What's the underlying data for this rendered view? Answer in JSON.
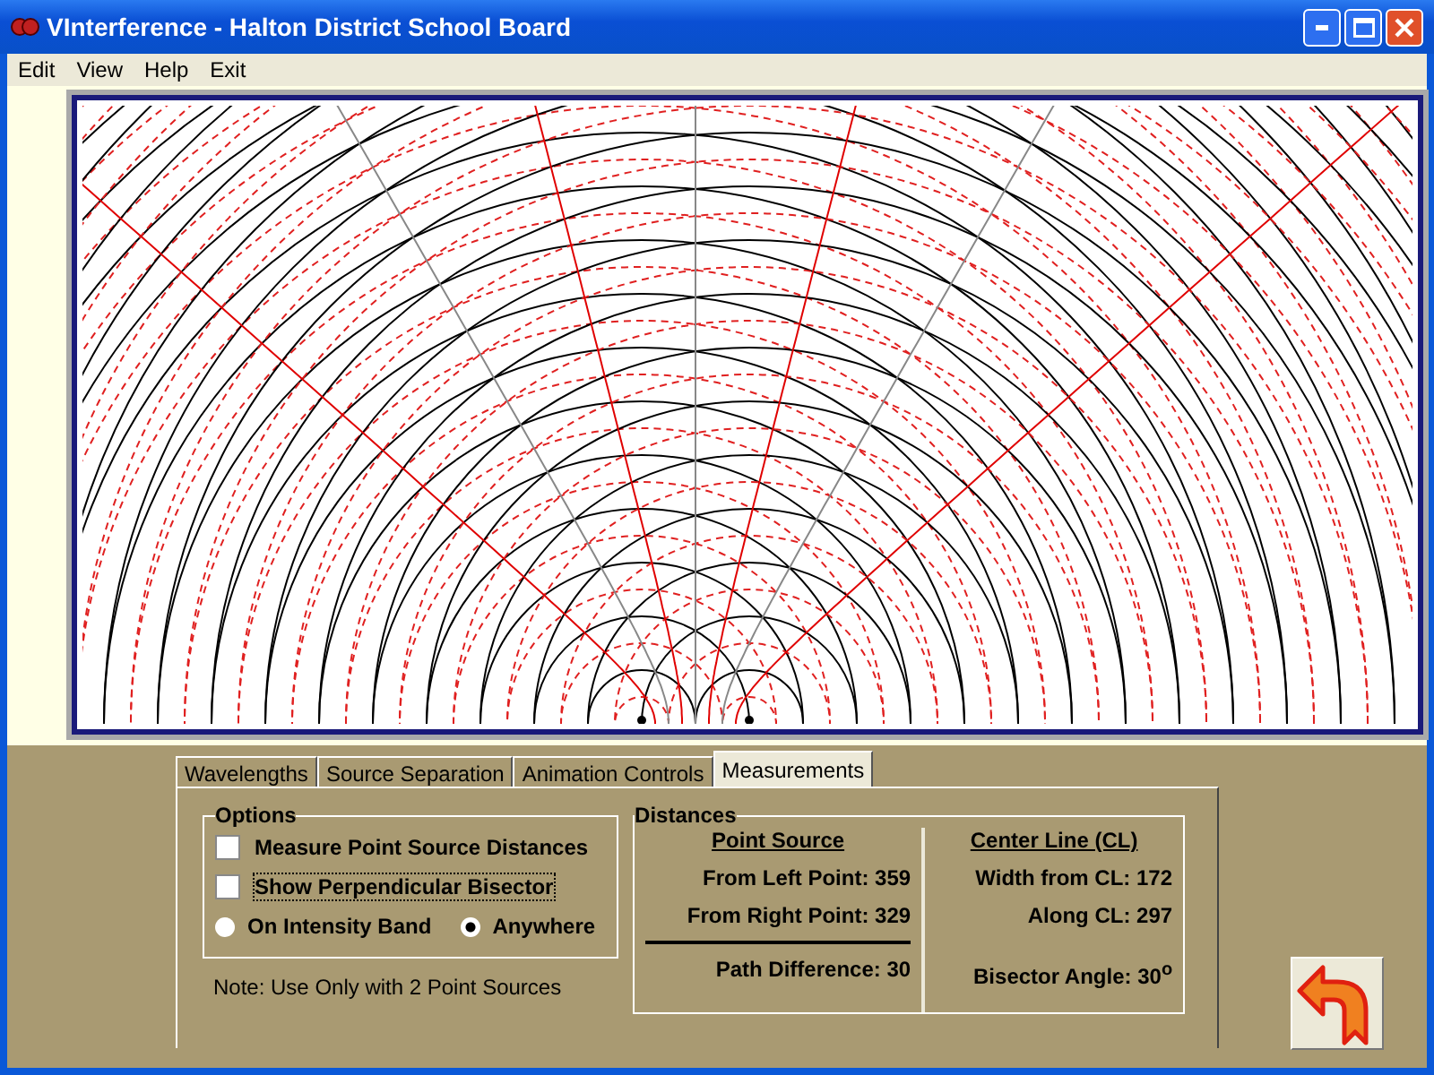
{
  "window": {
    "title": "VInterference - Halton District School Board"
  },
  "menu": [
    "Edit",
    "View",
    "Help",
    "Exit"
  ],
  "tabs": [
    {
      "label": "Wavelengths",
      "selected": false
    },
    {
      "label": "Source Separation",
      "selected": false
    },
    {
      "label": "Animation Controls",
      "selected": false
    },
    {
      "label": "Measurements",
      "selected": true
    }
  ],
  "options": {
    "title": "Options",
    "checkboxes": [
      {
        "label": "Measure Point Source Distances",
        "checked": false,
        "focused": false
      },
      {
        "label": "Show Perpendicular Bisector",
        "checked": false,
        "focused": true
      }
    ],
    "radios": [
      {
        "label": "On Intensity Band",
        "selected": false
      },
      {
        "label": "Anywhere",
        "selected": true
      }
    ],
    "note": "Note: Use Only with 2 Point Sources"
  },
  "distances": {
    "title": "Distances",
    "point_source": {
      "heading": "Point Source",
      "rows": [
        "From Left Point: 359",
        "From Right Point: 329"
      ],
      "total": "Path Difference: 30"
    },
    "center_line": {
      "heading": "Center Line (CL)",
      "rows": [
        "Width from CL: 172",
        "Along CL: 297"
      ],
      "angle": "Bisector Angle: 30$^{o}$"
    }
  }
}
